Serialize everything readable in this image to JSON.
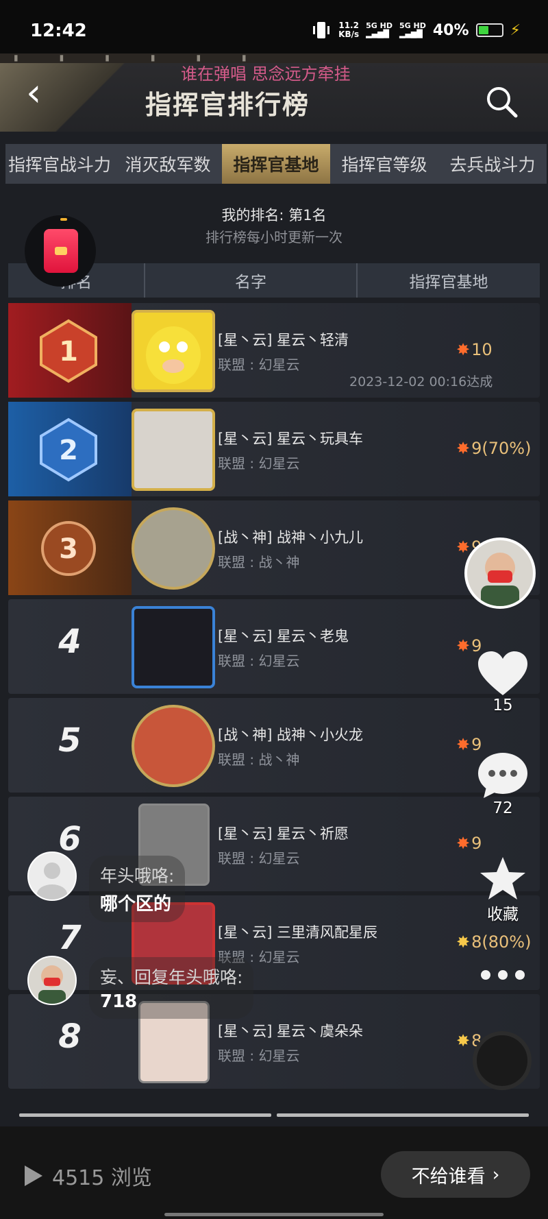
{
  "status_bar": {
    "time": "12:42",
    "net_speed": "11.2",
    "net_unit": "KB/s",
    "sig1": "5G HD",
    "sig2": "5G HD",
    "battery": "40%"
  },
  "game": {
    "title": "指挥官排行榜",
    "danmu": "谁在弹唱 思念远方牵挂",
    "tabs": [
      "指挥官战斗力",
      "消灭敌军数",
      "指挥官基地",
      "指挥官等级",
      "去兵战斗力"
    ],
    "active_tab_index": 2,
    "my_rank": "我的排名: 第1名",
    "update_tip": "排行榜每小时更新一次",
    "columns": [
      "排名",
      "名字",
      "指挥官基地"
    ],
    "rows": [
      {
        "rank": "1",
        "name": "[星丶云] 星云丶轻清",
        "alliance": "联盟 : 幻星云",
        "score": "10",
        "date": "2023-12-02 00:16达成"
      },
      {
        "rank": "2",
        "name": "[星丶云] 星云丶玩具车",
        "alliance": "联盟 : 幻星云",
        "score": "9(70%)"
      },
      {
        "rank": "3",
        "name": "[战丶神] 战神丶小九儿",
        "alliance": "联盟 : 战丶神",
        "score": "9"
      },
      {
        "rank": "4",
        "name": "[星丶云] 星云丶老鬼",
        "alliance": "联盟 : 幻星云",
        "score": "9"
      },
      {
        "rank": "5",
        "name": "[战丶神] 战神丶小火龙",
        "alliance": "联盟 : 战丶神",
        "score": "9"
      },
      {
        "rank": "6",
        "name": "[星丶云] 星云丶祈愿",
        "alliance": "联盟 : 幻星云",
        "score": "9"
      },
      {
        "rank": "7",
        "name": "[星丶云] 三里清风配星辰",
        "alliance": "联盟 : 幻星云",
        "score": "8(80%)"
      },
      {
        "rank": "8",
        "name": "[星丶云] 星云丶虞朵朵",
        "alliance": "联盟 : 幻星云",
        "score": "8"
      }
    ]
  },
  "overlay": {
    "likes": "15",
    "comments": "72",
    "favorite_label": "收藏",
    "comment1_user": "年头哦咯:",
    "comment1_text": "哪个区的",
    "comment2_user": "妄、回复年头哦咯:",
    "comment2_text": "718"
  },
  "bottom_bar": {
    "views": "4515 浏览",
    "visibility_button": "不给谁看"
  },
  "colors": {
    "tab_active": "#c8ab6b",
    "score_gold": "#e9c07a",
    "rank1_red": "#a11c20",
    "rank2_blue": "#1d5fa6",
    "rank3_bronze": "#8a4516"
  }
}
